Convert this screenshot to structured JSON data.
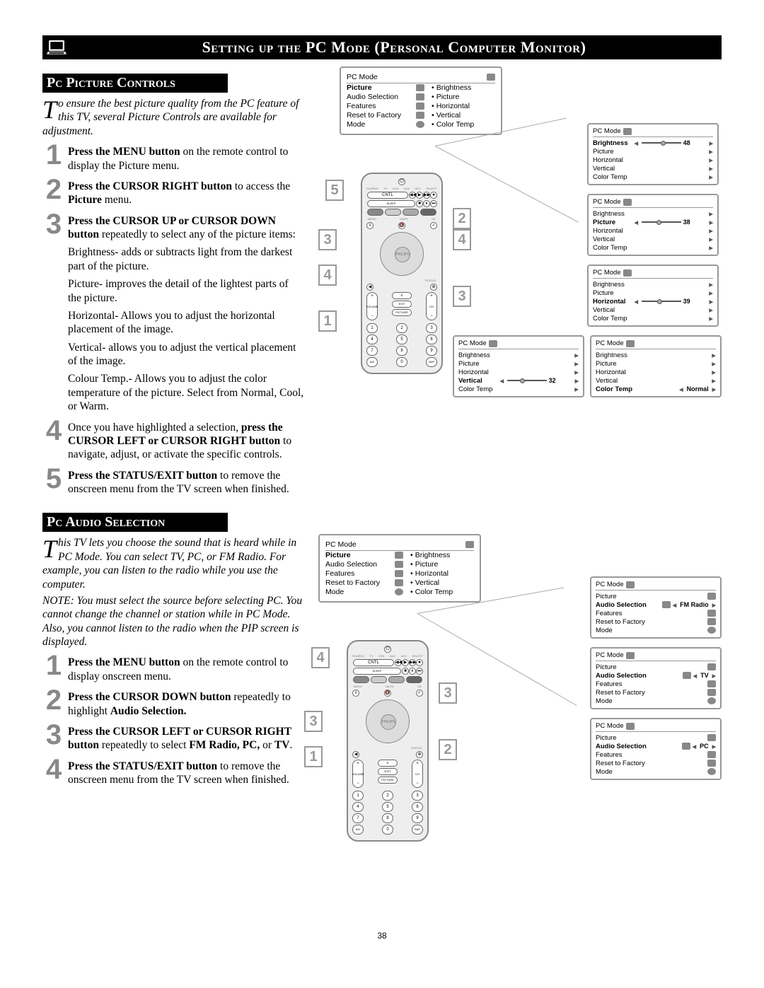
{
  "page_title": "Setting up the PC Mode (Personal Computer Monitor)",
  "page_number": "38",
  "sections": {
    "picture": {
      "header": "Pc Picture Controls",
      "intro_first": "T",
      "intro_rest": "o ensure the best picture quality from the PC feature of this TV, several Picture Controls are available for adjustment.",
      "steps": {
        "s1": {
          "num": "1",
          "b1": "Press the MENU button",
          "t1": " on the remote control to display the Picture menu."
        },
        "s2": {
          "num": "2",
          "b1": "Press the CURSOR RIGHT button",
          "t1": " to access the ",
          "b2": "Picture",
          "t2": " menu."
        },
        "s3": {
          "num": "3",
          "b1": "Press the CURSOR UP or CURSOR DOWN button",
          "t1": " repeatedly to select any of the picture items:"
        },
        "sub1": "Brightness- adds or subtracts light from the darkest part of the picture.",
        "sub2": "Picture- improves the detail of the lightest parts of the picture.",
        "sub3": "Horizontal- Allows you to adjust the horizontal placement of the image.",
        "sub4": "Vertical- allows you to adjust the vertical placement of the image.",
        "sub5": "Colour Temp.- Allows you to adjust the color temperature of the picture. Select from Normal, Cool, or Warm.",
        "s4": {
          "num": "4",
          "t0": "Once you have highlighted a selection, ",
          "b1": "press the CURSOR LEFT or CURSOR RIGHT button",
          "t1": " to navigate, adjust, or activate the specific controls."
        },
        "s5": {
          "num": "5",
          "b1": "Press the STATUS/EXIT button",
          "t1": " to remove the onscreen menu from the TV screen when finished."
        }
      }
    },
    "audio": {
      "header": "Pc Audio Selection",
      "intro_first": "T",
      "intro_rest": "his TV lets you choose the sound that is heard while in PC Mode.  You can select TV, PC, or FM Radio. For example, you can listen to the radio while you use the computer.",
      "note": "NOTE: You must select the source before selecting PC. You cannot change the channel or station while in PC Mode.  Also, you cannot listen to the radio when the PIP screen is displayed.",
      "steps": {
        "s1": {
          "num": "1",
          "b1": "Press the MENU button",
          "t1": " on the remote control to display onscreen menu."
        },
        "s2": {
          "num": "2",
          "b1": "Press the CURSOR DOWN button",
          "t1": " repeatedly to highlight ",
          "b2": "Audio Selection."
        },
        "s3": {
          "num": "3",
          "b1": "Press the CURSOR LEFT or CURSOR RIGHT button",
          "t1": " repeatedly to select ",
          "b2": "FM Radio, PC,",
          "t2": " or ",
          "b3": "TV",
          "t3": "."
        },
        "s4": {
          "num": "4",
          "b1": "Press the STATUS/EXIT button",
          "t1": " to remove the onscreen menu from the TV screen when finished."
        }
      }
    }
  },
  "menu_main": {
    "title": "PC Mode",
    "left": [
      "Picture",
      "Audio Selection",
      "Features",
      "Reset to Factory",
      "Mode"
    ],
    "right": [
      "Brightness",
      "Picture",
      "Horizontal",
      "Vertical",
      "Color Temp"
    ]
  },
  "osd_picture": [
    {
      "title": "PC Mode",
      "items": [
        "Brightness",
        "Picture",
        "Horizontal",
        "Vertical",
        "Color Temp"
      ],
      "highlighted": "Brightness",
      "value": "48",
      "slider": "p48"
    },
    {
      "title": "PC Mode",
      "items": [
        "Brightness",
        "Picture",
        "Horizontal",
        "Vertical",
        "Color Temp"
      ],
      "highlighted": "Picture",
      "value": "38",
      "slider": "p38"
    },
    {
      "title": "PC Mode",
      "items": [
        "Brightness",
        "Picture",
        "Horizontal",
        "Vertical",
        "Color Temp"
      ],
      "highlighted": "Horizontal",
      "value": "39",
      "slider": "p39"
    },
    {
      "title": "PC Mode",
      "items": [
        "Brightness",
        "Picture",
        "Horizontal",
        "Vertical",
        "Color Temp"
      ],
      "highlighted": "Vertical",
      "value": "32",
      "slider": "p32"
    },
    {
      "title": "PC Mode",
      "items": [
        "Brightness",
        "Picture",
        "Horizontal",
        "Vertical",
        "Color Temp"
      ],
      "highlighted": "Color Temp",
      "value": "Normal",
      "slider": ""
    }
  ],
  "osd_audio": [
    {
      "title": "PC Mode",
      "items": [
        "Picture",
        "Audio Selection",
        "Features",
        "Reset to Factory",
        "Mode"
      ],
      "highlighted": "Audio Selection",
      "value": "FM Radio"
    },
    {
      "title": "PC Mode",
      "items": [
        "Picture",
        "Audio Selection",
        "Features",
        "Reset to Factory",
        "Mode"
      ],
      "highlighted": "Audio Selection",
      "value": "TV"
    },
    {
      "title": "PC Mode",
      "items": [
        "Picture",
        "Audio Selection",
        "Features",
        "Reset to Factory",
        "Mode"
      ],
      "highlighted": "Audio Selection",
      "value": "PC"
    }
  ],
  "remote_labels": {
    "power": "⏻",
    "row1": [
      "TV",
      "DVD",
      "AUX",
      "ACC",
      "SELECT"
    ],
    "row2": [
      "CNTL",
      "◀◀",
      "▶",
      "▶▶",
      "⏺"
    ],
    "row_small": [
      "SLEEP",
      "■",
      "⏸",
      "⏭"
    ],
    "mute": "MUTE",
    "ok": "OK",
    "menu": "MENU",
    "status": "STATUS",
    "center": "PHILIPS",
    "vol": "VOLUME",
    "ch": "CH",
    "mid": [
      "≡",
      "EXIT",
      "PICTURE"
    ],
    "numpad": [
      [
        "1",
        "2",
        "3"
      ],
      [
        "4",
        "5",
        "6"
      ],
      [
        "7",
        "8",
        "9"
      ],
      [
        "A/D",
        "0",
        "SAP"
      ]
    ]
  },
  "callouts_picture": [
    "1",
    "2",
    "3",
    "4",
    "5"
  ],
  "callouts_audio": [
    "1",
    "2",
    "3",
    "4"
  ]
}
